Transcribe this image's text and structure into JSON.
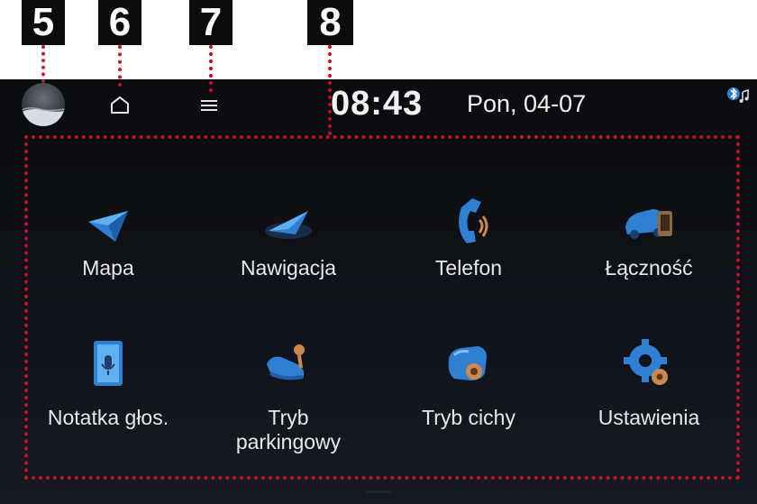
{
  "callouts": [
    "5",
    "6",
    "7",
    "8"
  ],
  "status_bar": {
    "time": "08:43",
    "date": "Pon, 04-07",
    "home_icon": "home-icon",
    "menu_icon": "menu-icon",
    "bluetooth_icon": "bluetooth-audio-icon"
  },
  "apps": [
    {
      "label": "Mapa",
      "icon": "map-icon"
    },
    {
      "label": "Nawigacja",
      "icon": "navigation-icon"
    },
    {
      "label": "Telefon",
      "icon": "phone-icon"
    },
    {
      "label": "Łączność",
      "icon": "connectivity-icon"
    },
    {
      "label": "Notatka głos.",
      "icon": "voice-memo-icon"
    },
    {
      "label": "Tryb\nparkingowy",
      "icon": "parking-mode-icon"
    },
    {
      "label": "Tryb cichy",
      "icon": "quiet-mode-icon"
    },
    {
      "label": "Ustawienia",
      "icon": "settings-icon"
    }
  ],
  "colors": {
    "callout_bg": "#0b0b0b",
    "leader": "#c4102a",
    "icon_blue": "#2f7fd3",
    "accent_orange": "#c98a52",
    "screen_bg": "#0f1218"
  }
}
